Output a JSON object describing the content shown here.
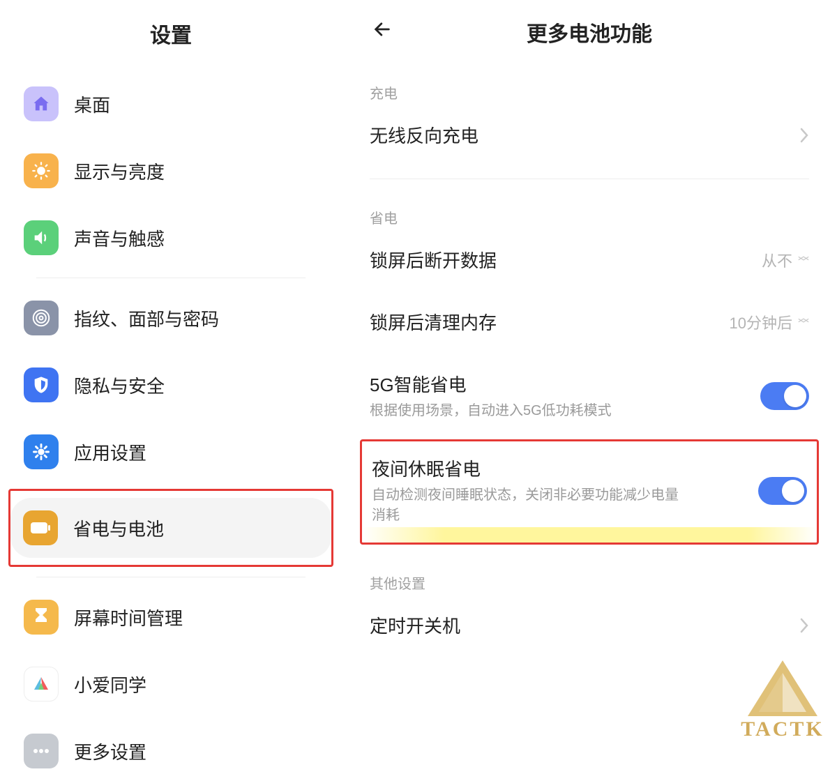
{
  "left": {
    "title": "设置",
    "items": [
      {
        "label": "桌面",
        "icon": "home-icon",
        "bg": "#9b8cf7",
        "innerBg": "#c9c2fb"
      },
      {
        "label": "显示与亮度",
        "icon": "brightness-icon",
        "bg": "#f8b24c"
      },
      {
        "label": "声音与触感",
        "icon": "sound-icon",
        "bg": "#5bd07a"
      },
      {
        "label": "指纹、面部与密码",
        "icon": "fingerprint-icon",
        "bg": "#8a93a8"
      },
      {
        "label": "隐私与安全",
        "icon": "shield-icon",
        "bg": "#3f74f2"
      },
      {
        "label": "应用设置",
        "icon": "apps-icon",
        "bg": "#2f80ed"
      },
      {
        "label": "省电与电池",
        "icon": "battery-icon",
        "bg": "#e8a531",
        "selected": true,
        "boxed": true
      },
      {
        "label": "屏幕时间管理",
        "icon": "hourglass-icon",
        "bg": "#f5b94c"
      },
      {
        "label": "小爱同学",
        "icon": "xiaoai-icon",
        "bg": "#ffffff",
        "multicolor": true
      },
      {
        "label": "更多设置",
        "icon": "more-icon",
        "bg": "#9aa1aa"
      }
    ],
    "dividers_after": [
      2,
      6
    ]
  },
  "right": {
    "title": "更多电池功能",
    "sections": [
      {
        "header": "充电",
        "rows": [
          {
            "title": "无线反向充电",
            "trailing_type": "chevron"
          }
        ],
        "divider_after": true
      },
      {
        "header": "省电",
        "rows": [
          {
            "title": "锁屏后断开数据",
            "trailing_type": "picker",
            "trailing_value": "从不"
          },
          {
            "title": "锁屏后清理内存",
            "trailing_type": "picker",
            "trailing_value": "10分钟后"
          },
          {
            "title": "5G智能省电",
            "subtitle": "根据使用场景，自动进入5G低功耗模式",
            "trailing_type": "toggle",
            "toggle_on": true
          },
          {
            "title": "夜间休眠省电",
            "subtitle": "自动检测夜间睡眠状态，关闭非必要功能减少电量消耗",
            "trailing_type": "toggle",
            "toggle_on": true,
            "boxed": true,
            "highlighted": true
          }
        ]
      },
      {
        "header": "其他设置",
        "rows": [
          {
            "title": "定时开关机",
            "trailing_type": "chevron"
          }
        ]
      }
    ]
  },
  "watermark": "TACTK"
}
